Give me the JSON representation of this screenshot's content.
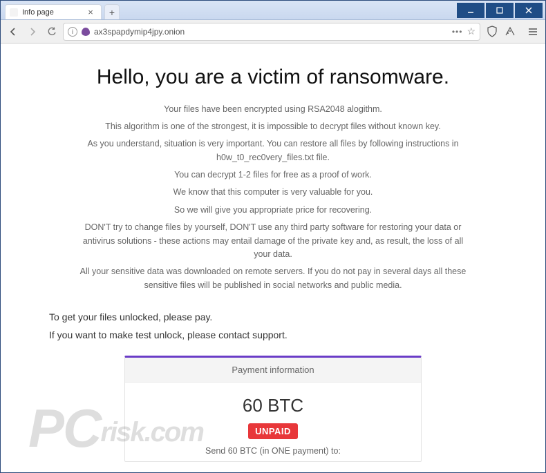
{
  "tab": {
    "title": "Info page"
  },
  "url": "ax3spapdymip4jpy.onion",
  "page": {
    "heading": "Hello, you are a victim of ransomware.",
    "p1": "Your files have been encrypted using RSA2048 alogithm.",
    "p2": "This algorithm is one of the strongest, it is impossible to decrypt files without known key.",
    "p3": "As you understand, situation is very important. You can restore all files by following instructions in h0w_t0_rec0very_files.txt file.",
    "p4": "You can decrypt 1-2 files for free as a proof of work.",
    "p5": "We know that this computer is very valuable for you.",
    "p6": "So we will give you appropriate price for recovering.",
    "p7": "DON'T try to change files by yourself, DON'T use any third party software for restoring your data or antivirus solutions - these actions may entail damage of the private key and, as result, the loss of all your data.",
    "p8": "All your sensitive data was downloaded on remote servers. If you do not pay in several days all these sensitive files will be published in social networks and public media.",
    "instr1": "To get your files unlocked, please pay.",
    "instr2": "If you want to make test unlock, please contact support."
  },
  "payment": {
    "header": "Payment information",
    "amount": "60 BTC",
    "status": "UNPAID",
    "send_line": "Send 60 BTC (in ONE payment) to:"
  },
  "watermark": {
    "main": "PC",
    "sub": "risk.com"
  }
}
